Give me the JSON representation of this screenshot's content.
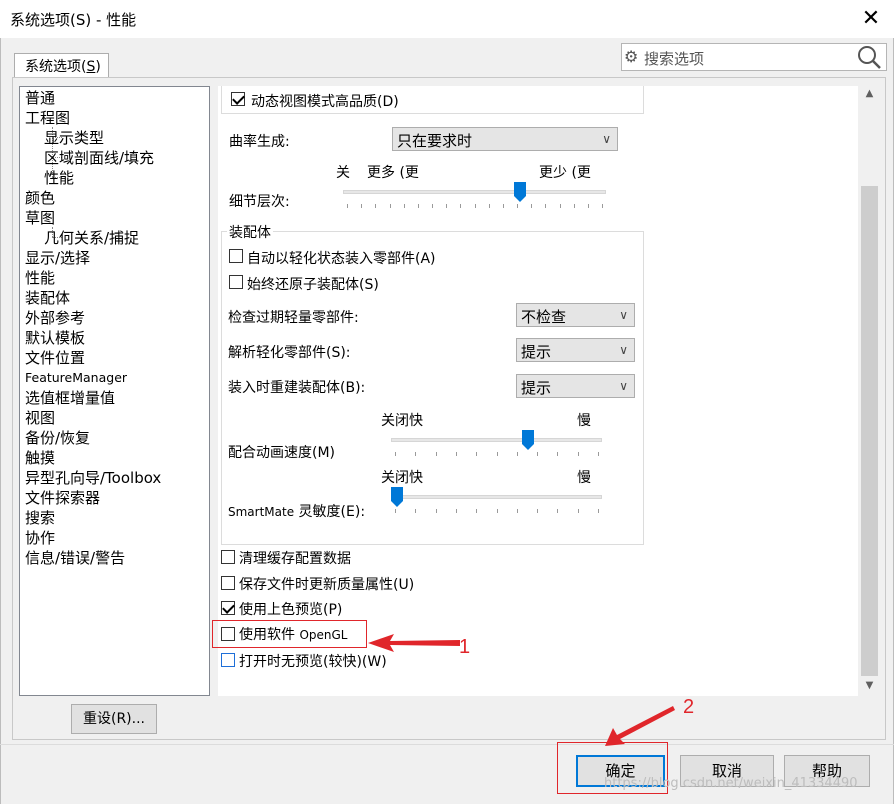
{
  "window": {
    "title": "系统选项(S) - 性能",
    "close_glyph": "✕"
  },
  "tab": {
    "label": "系统选项",
    "mnemonic": "S"
  },
  "search": {
    "placeholder": "搜索选项"
  },
  "tree": {
    "items": [
      {
        "label": "普通",
        "indent": false
      },
      {
        "label": "工程图",
        "indent": false
      },
      {
        "label": "显示类型",
        "indent": true
      },
      {
        "label": "区域剖面线/填充",
        "indent": true
      },
      {
        "label": "性能",
        "indent": true
      },
      {
        "label": "颜色",
        "indent": false
      },
      {
        "label": "草图",
        "indent": false
      },
      {
        "label": "几何关系/捕捉",
        "indent": true
      },
      {
        "label": "显示/选择",
        "indent": false
      },
      {
        "label": "性能",
        "indent": false
      },
      {
        "label": "装配体",
        "indent": false
      },
      {
        "label": "外部参考",
        "indent": false
      },
      {
        "label": "默认模板",
        "indent": false
      },
      {
        "label": "文件位置",
        "indent": false
      },
      {
        "label": "FeatureManager",
        "indent": false
      },
      {
        "label": "选值框增量值",
        "indent": false
      },
      {
        "label": "视图",
        "indent": false
      },
      {
        "label": "备份/恢复",
        "indent": false
      },
      {
        "label": "触摸",
        "indent": false
      },
      {
        "label": "异型孔向导/Toolbox",
        "indent": false
      },
      {
        "label": "文件探索器",
        "indent": false
      },
      {
        "label": "搜索",
        "indent": false
      },
      {
        "label": "协作",
        "indent": false
      },
      {
        "label": "信息/错误/警告",
        "indent": false
      }
    ]
  },
  "reset_button": "重设(R)...",
  "options": {
    "dynamic_view_hq": {
      "label": "动态视图模式高品质(D)",
      "checked": true
    },
    "curvature": {
      "label": "曲率生成:",
      "value": "只在要求时"
    },
    "detail_level": {
      "label": "细节层次:",
      "left_label": "关",
      "mid_label": "更多 (更",
      "right_label": "更少 (更",
      "level": 0.68
    },
    "assembly_group": {
      "title": "装配体",
      "auto_lightweight": {
        "label": "自动以轻化状态装入零部件(A)",
        "checked": false
      },
      "always_resolve": {
        "label": "始终还原子装配体(S)",
        "checked": false
      },
      "check_outdated": {
        "label": "检查过期轻量零部件:",
        "value": "不检查"
      },
      "resolve_lightweight": {
        "label": "解析轻化零部件(S):",
        "value": "提示"
      },
      "rebuild_on_load": {
        "label": "装入时重建装配体(B):",
        "value": "提示"
      },
      "mate_anim_speed": {
        "label": "配合动画速度(M)",
        "left_label": "关闭快",
        "right_label": "慢",
        "level": 0.66
      },
      "smartmate": {
        "label_latin": "SmartMate",
        "label": "灵敏度(E):",
        "left_label": "关闭快",
        "right_label": "慢",
        "level": 0.0
      }
    },
    "purge_cache": {
      "label": "清理缓存配置数据",
      "checked": false
    },
    "update_mass_props": {
      "label": "保存文件时更新质量属性(U)",
      "checked": false
    },
    "shaded_preview": {
      "label": "使用上色预览(P)",
      "checked": true
    },
    "software_opengl": {
      "label": "使用软件",
      "label_latin": "OpenGL",
      "checked": false
    },
    "no_preview": {
      "label": "打开时无预览(较快)(W)",
      "checked": false
    }
  },
  "buttons": {
    "ok": "确定",
    "cancel": "取消",
    "help": "帮助"
  },
  "annotations": {
    "marker_1": "1",
    "marker_2": "2",
    "color": "#e0262b"
  },
  "watermark": "https://blog.csdn.net/weixin_41334490",
  "colors": {
    "accent": "#0078d7",
    "annotation": "#e0262b"
  }
}
